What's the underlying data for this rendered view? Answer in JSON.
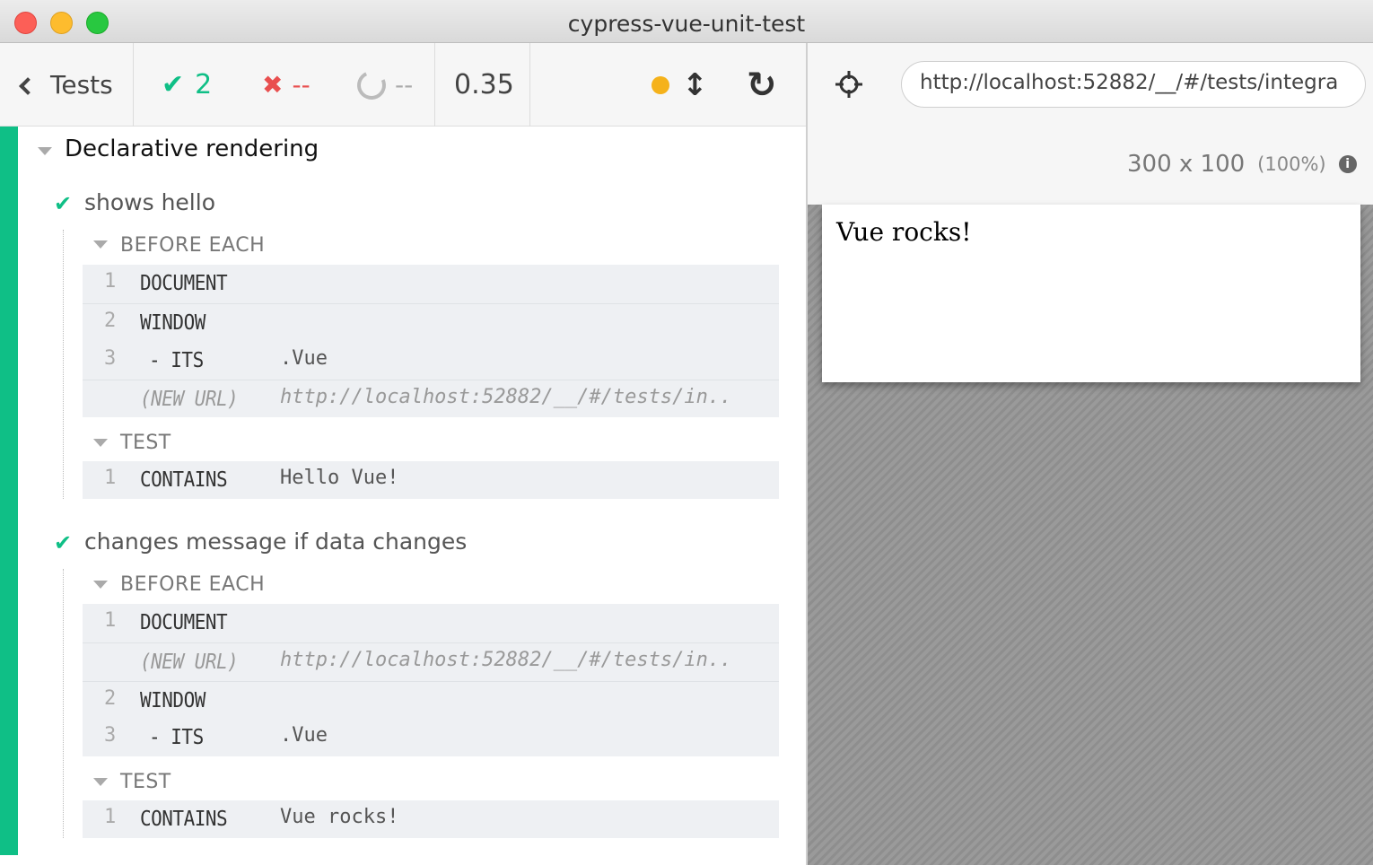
{
  "window": {
    "title": "cypress-vue-unit-test"
  },
  "header": {
    "tests_label": "Tests",
    "passed_count": "2",
    "failed_count": "--",
    "pending_count": "--",
    "duration": "0.35",
    "colors": {
      "pass": "#0fbf86",
      "fail": "#e94f4f",
      "autoscroll": "#f5b21b"
    }
  },
  "suite": {
    "title": "Declarative rendering",
    "tests": [
      {
        "title": "shows hello",
        "before_each": {
          "label": "BEFORE EACH",
          "commands": [
            {
              "num": "1",
              "name": "DOCUMENT",
              "message": ""
            },
            {
              "num": "2",
              "name": "WINDOW",
              "message": ""
            },
            {
              "num": "3",
              "name": "- ITS",
              "message": ".Vue"
            },
            {
              "num": "",
              "name": "(NEW URL)",
              "message": "http://localhost:52882/__/#/tests/in.."
            }
          ]
        },
        "test": {
          "label": "TEST",
          "commands": [
            {
              "num": "1",
              "name": "CONTAINS",
              "message": "Hello Vue!"
            }
          ]
        }
      },
      {
        "title": "changes message if data changes",
        "before_each": {
          "label": "BEFORE EACH",
          "commands": [
            {
              "num": "1",
              "name": "DOCUMENT",
              "message": ""
            },
            {
              "num": "",
              "name": "(NEW URL)",
              "message": "http://localhost:52882/__/#/tests/in.."
            },
            {
              "num": "2",
              "name": "WINDOW",
              "message": ""
            },
            {
              "num": "3",
              "name": "- ITS",
              "message": ".Vue"
            }
          ]
        },
        "test": {
          "label": "TEST",
          "commands": [
            {
              "num": "1",
              "name": "CONTAINS",
              "message": "Vue rocks!"
            }
          ]
        }
      }
    ]
  },
  "aut": {
    "url": "http://localhost:52882/__/#/tests/integra",
    "viewport_size": "300 x 100",
    "viewport_scale": "(100%)",
    "content_text": "Vue rocks!"
  }
}
